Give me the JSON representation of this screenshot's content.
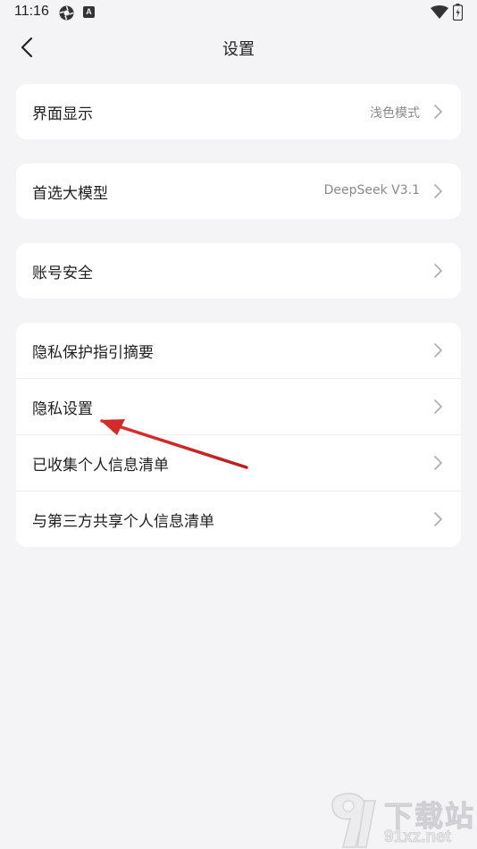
{
  "status_bar": {
    "time": "11:16",
    "badge_letter": "A"
  },
  "header": {
    "title": "设置"
  },
  "sections": [
    {
      "rows": [
        {
          "label": "界面显示",
          "value": "浅色模式"
        }
      ]
    },
    {
      "rows": [
        {
          "label": "首选大模型",
          "value": "DeepSeek V3.1"
        }
      ]
    },
    {
      "rows": [
        {
          "label": "账号安全",
          "value": ""
        }
      ]
    },
    {
      "rows": [
        {
          "label": "隐私保护指引摘要",
          "value": ""
        },
        {
          "label": "隐私设置",
          "value": ""
        },
        {
          "label": "已收集个人信息清单",
          "value": ""
        },
        {
          "label": "与第三方共享个人信息清单",
          "value": ""
        }
      ]
    }
  ],
  "annotation": {
    "arrow_color": "#d42a2a",
    "target": "隐私设置"
  },
  "watermark": {
    "title": "下载站",
    "domain": "91xz.net"
  },
  "colors": {
    "background": "#f4f4f6",
    "card": "#ffffff",
    "secondary_text": "#8a8a8a",
    "chevron": "#b0b0b0"
  }
}
